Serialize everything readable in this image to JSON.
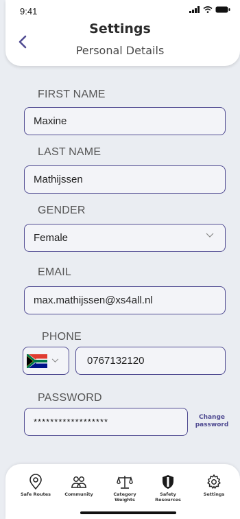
{
  "status_bar": {
    "time": "9:41"
  },
  "header": {
    "title": "Settings",
    "subtitle": "Personal Details"
  },
  "form": {
    "first_name": {
      "label": "FIRST NAME",
      "value": "Maxine"
    },
    "last_name": {
      "label": "LAST NAME",
      "value": "Mathijssen"
    },
    "gender": {
      "label": "GENDER",
      "value": "Female"
    },
    "email": {
      "label": "EMAIL",
      "value": "max.mathijssen@xs4all.nl"
    },
    "phone": {
      "label": "PHONE",
      "value": "0767132120",
      "country_flag": "south-africa-flag-icon"
    },
    "password": {
      "label": "PASSWORD",
      "value": "******************",
      "change_label_line1": "Change",
      "change_label_line2": "password"
    }
  },
  "nav": {
    "items": [
      {
        "label": "Safe Routes",
        "icon": "location-pin-icon"
      },
      {
        "label": "Community",
        "icon": "people-icon"
      },
      {
        "label_line1": "Category",
        "label_line2": "Weights",
        "icon": "scales-icon"
      },
      {
        "label_line1": "Safety",
        "label_line2": "Resources",
        "icon": "shield-icon"
      },
      {
        "label": "Settings",
        "icon": "gear-icon"
      }
    ]
  },
  "colors": {
    "accent": "#4f4a91",
    "background": "#eaedf2",
    "field_bg": "#f3f4f8"
  }
}
